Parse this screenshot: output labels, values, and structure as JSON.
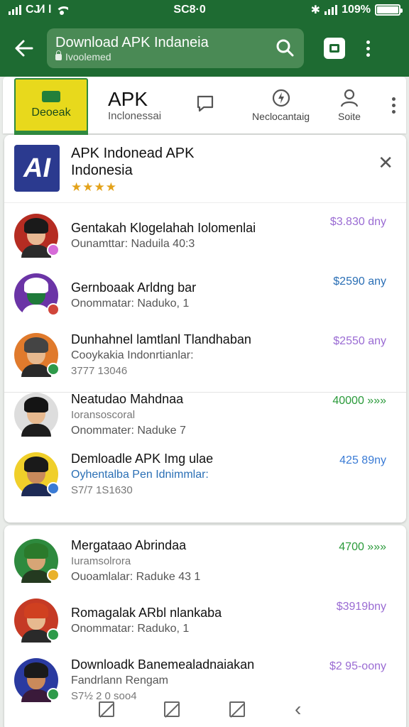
{
  "status": {
    "left": "CJ⁄l l",
    "time": "SC8·0",
    "battery": "109%",
    "battery_level": 1.0
  },
  "toolbar": {
    "title": "Download APK Indaneia",
    "subtitle": "Ivoolemed",
    "icons": [
      "back-arrow-icon",
      "search-icon",
      "tabs-icon",
      "more-vert-icon"
    ]
  },
  "app": {
    "logo_text": "Deoeak",
    "name": "APK",
    "sub": "Inclonessai",
    "nav": [
      {
        "label": "",
        "icon": "chat-bubble-icon"
      },
      {
        "label": "Neclocantaig",
        "icon": "bolt-circle-icon"
      },
      {
        "label": "Soite",
        "icon": "person-icon"
      }
    ]
  },
  "header": {
    "title_line1": "APK Indonead APK",
    "title_line2": "Indonesia",
    "stars": "★★★★",
    "rating": 3.5
  },
  "rows": [
    {
      "t1": "Gentakah Klogelahah Iolomenlai",
      "t2": "Ounamttar: Naduila 40:3",
      "t3": "",
      "price": "$3.830 dny",
      "price_color": "#9a6bd3",
      "skin": "#e8b893",
      "hair": "#1a1a1a",
      "bg": "#b52c22",
      "body": "#2b2b2b",
      "badge": "#d66bd8"
    },
    {
      "t1": "Gernboaak Arldng bar",
      "t2": "Onommatar: Naduko, 1",
      "t3": "",
      "price": "$2590 any",
      "price_color": "#2a6fb5",
      "skin": "#1f7a3a",
      "hair": "#ffffff",
      "bg": "#6b34a6",
      "body": "#ffffff",
      "badge": "#d0453a"
    },
    {
      "t1": "Dunhahnel lamtlanl Tlandhaban",
      "t2": "Cooykakia Indonrtianlar:",
      "t3": "3777 13046",
      "price": "$2550 any",
      "price_color": "#9a6bd3",
      "skin": "#e7b98f",
      "hair": "#444444",
      "bg": "#e07a2c",
      "body": "#2a2a2a",
      "badge": "#2e9a4a"
    },
    {
      "t1": "Neatudao Mahdnaa",
      "t1b": "Ioransoscoral",
      "t2": "Onommater: Naduke 7",
      "t3": "",
      "price": "40000 »»»",
      "price_color": "#2a9a3a",
      "skin": "#e7b98f",
      "hair": "#141414",
      "bg": "#dddddd",
      "body": "#1d1d1d",
      "badge": ""
    },
    {
      "t1": "Demloadle APK Img ulae",
      "t2": "Oyhentalba Pen Idnimmlar:",
      "t3": "S7/7 1S1630",
      "price": "425 89ny",
      "price_color": "#3a7bd5",
      "skin": "#c98a5b",
      "hair": "#1a1a1a",
      "bg": "#f0cf2a",
      "body": "#1d2a55",
      "badge": "#3a7bd5"
    }
  ],
  "rows2": [
    {
      "t1": "Mergataao Abrindaa",
      "t1b": "Iuramsolrora",
      "t2": "Ouoamlalar: Raduke 43 1",
      "t3": "",
      "price": "4700 »»»",
      "price_color": "#2a9a3a",
      "skin": "#d7a576",
      "hair": "#2b7a2b",
      "bg": "#2e8a3e",
      "body": "#243a20",
      "badge": "#e9b12a"
    },
    {
      "t1": "Romagalak ARbl nlankaba",
      "t2": "Onommatar: Raduko, 1",
      "t3": "",
      "price": "$3919bny",
      "price_color": "#9a6bd3",
      "skin": "#e7b98f",
      "hair": "#d04020",
      "bg": "#c53a25",
      "body": "#2a2a2a",
      "badge": "#2e9a4a"
    },
    {
      "t1": "Downloadk Banemealadnaiakan",
      "t2": "Fandrlann Rengam",
      "t3": "S7½ 2 0 soo4",
      "price": "$2 95-oony",
      "price_color": "#9a6bd3",
      "skin": "#c98a5b",
      "hair": "#1a1a1a",
      "bg": "#2a3aa0",
      "body": "#3a1a3a",
      "badge": "#2e9a4a"
    }
  ],
  "colors": {
    "primary": "#1e6b32",
    "accent_purple": "#9a6bd3",
    "accent_green": "#2a9a3a",
    "accent_blue": "#2a6fb5"
  }
}
